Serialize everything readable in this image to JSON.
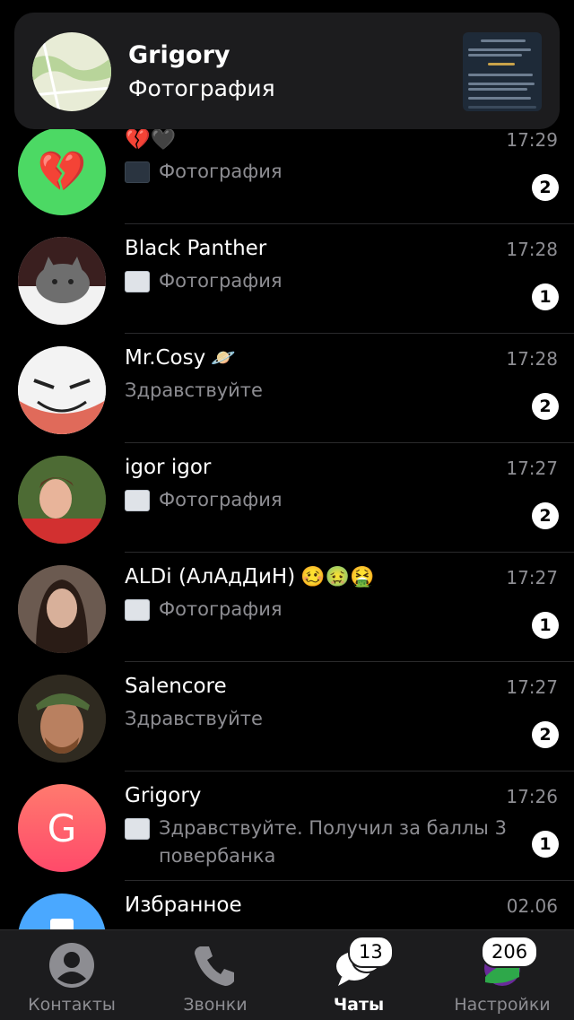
{
  "notification": {
    "title": "Grigory",
    "subtitle": "Фотография"
  },
  "chats": [
    {
      "name": "💔🖤",
      "time": "17:29",
      "message": "Фотография",
      "badge": "2",
      "avatar_icon": "broken-heart-icon"
    },
    {
      "name": "Black Panther",
      "time": "17:28",
      "message": "Фотография",
      "badge": "1",
      "avatar_icon": "cat-photo"
    },
    {
      "name": "Mr.Cosy",
      "name_emoji": "🪐",
      "time": "17:28",
      "message": "Здравствуйте",
      "badge": "2",
      "avatar_icon": "pokeball-face"
    },
    {
      "name": "igor igor",
      "time": "17:27",
      "message": "Фотография",
      "badge": "2",
      "avatar_icon": "person-photo"
    },
    {
      "name": "ALDi (АлАдДиН)",
      "name_emoji": "🥴🤢🤮",
      "time": "17:27",
      "message": "Фотография",
      "badge": "1",
      "avatar_icon": "person-photo"
    },
    {
      "name": "Salencore",
      "time": "17:27",
      "message": "Здравствуйте",
      "badge": "2",
      "avatar_icon": "person-photo"
    },
    {
      "name": "Grigory",
      "time": "17:26",
      "message": "Здравствуйте. Получил за баллы 3 повербанка",
      "badge": "1",
      "avatar_letter": "G"
    },
    {
      "name": "Избранное",
      "time": "02.06",
      "message": "",
      "badge": "",
      "avatar_icon": "bookmark-icon"
    }
  ],
  "tabbar": {
    "contacts": "Контакты",
    "calls": "Звонки",
    "chats": "Чаты",
    "chats_count": "13",
    "settings": "Настройки",
    "settings_count": "206"
  },
  "colors": {
    "background": "#000000",
    "badge": "#ffffff",
    "secondary_text": "#8d8d92",
    "green_avatar": "#4cd964",
    "grigory_avatar": "#ff5a6e",
    "saved_avatar": "#4aa8ff"
  }
}
